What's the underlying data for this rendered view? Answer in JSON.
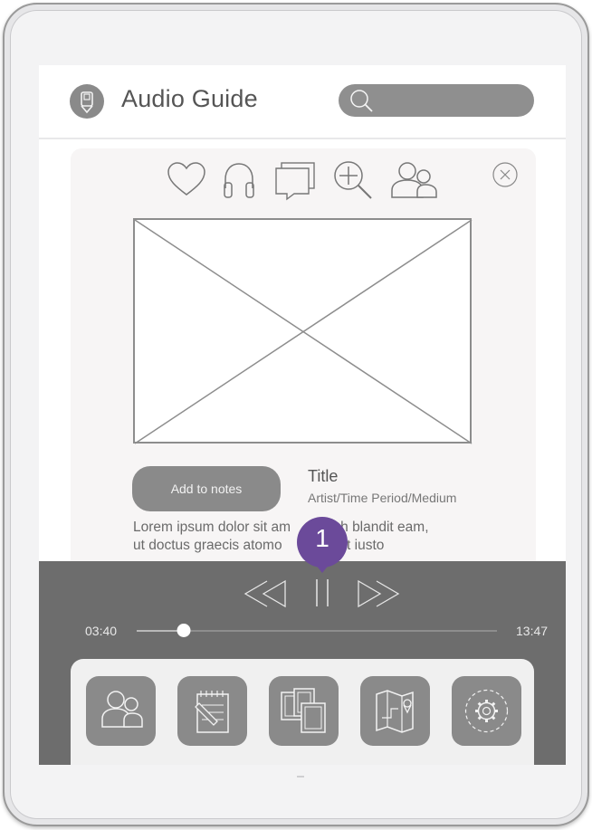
{
  "header": {
    "title": "Audio Guide",
    "logo_icon": "audio-device-icon",
    "search": {
      "placeholder": "",
      "icon": "search-icon"
    }
  },
  "card": {
    "action_icons": [
      "heart-icon",
      "headphones-icon",
      "comment-icon",
      "zoom-in-icon",
      "people-icon"
    ],
    "close_icon": "close-icon",
    "image_placeholder": "image-placeholder",
    "add_notes_label": "Add to notes",
    "artwork_title": "Title",
    "artwork_meta": "Artist/Time Period/Medium",
    "description_lines": [
      "Lorem ipsum dolor sit am        nibh blandit eam,",
      "ut doctus graecis atomo          Id sit iusto"
    ]
  },
  "player": {
    "current_time": "03:40",
    "total_time": "13:47",
    "progress_fraction": 0.13,
    "controls": [
      "rewind-icon",
      "pause-icon",
      "fast-forward-icon"
    ]
  },
  "tray": {
    "tiles": [
      "visitors-icon",
      "notes-icon",
      "gallery-icon",
      "map-icon",
      "settings-icon"
    ]
  },
  "annotation": {
    "badge_number": "1",
    "color": "#6b4a9a"
  },
  "colors": {
    "player_bg": "#6d6d6d",
    "button_gray": "#8a8a8a",
    "card_bg": "#f7f5f5"
  }
}
